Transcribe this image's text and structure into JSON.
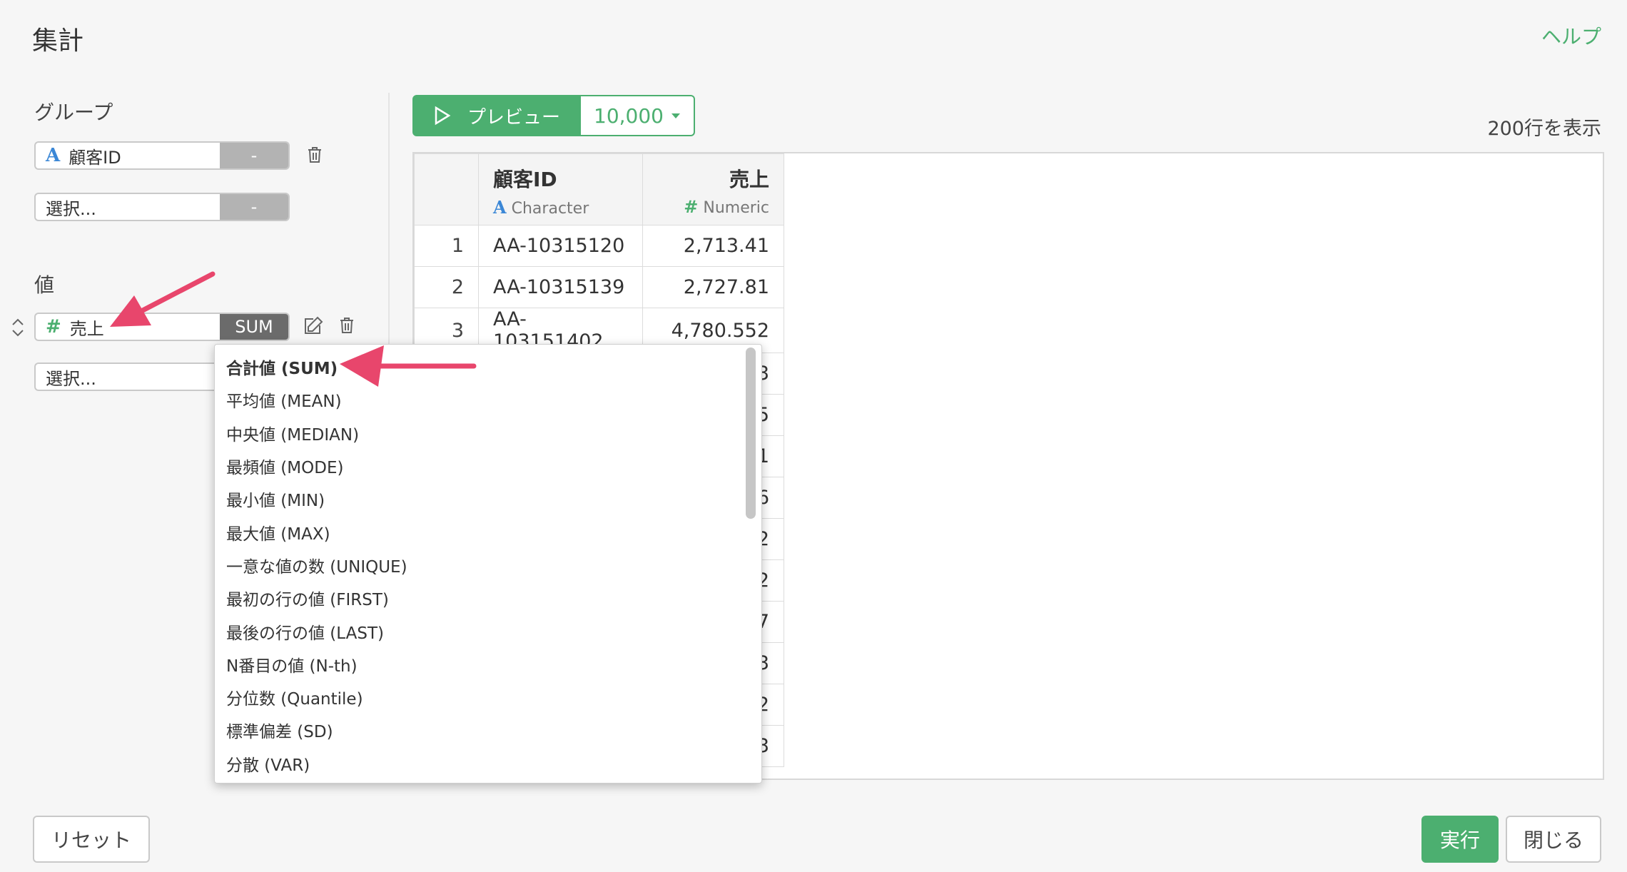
{
  "header": {
    "title": "集計",
    "help_label": "ヘルプ"
  },
  "left_panel": {
    "group_label": "グループ",
    "group_fields": [
      {
        "value": "顧客ID",
        "type_icon": "A",
        "button": "-"
      },
      {
        "placeholder": "選択...",
        "button": "-"
      }
    ],
    "value_label": "値",
    "value_fields": [
      {
        "value": "売上",
        "type_icon": "#",
        "button": "SUM"
      },
      {
        "placeholder": "選択..."
      }
    ]
  },
  "preview": {
    "button_label": "プレビュー",
    "count": "10,000",
    "rows_info": "200行を表示"
  },
  "table": {
    "columns": [
      {
        "name": "顧客ID",
        "type_icon": "A",
        "type": "Character"
      },
      {
        "name": "売上",
        "type_icon": "#",
        "type": "Numeric"
      }
    ],
    "rows": [
      {
        "index": "1",
        "id": "AA-10315120",
        "value": "2,713.41"
      },
      {
        "index": "2",
        "id": "AA-10315139",
        "value": "2,727.81"
      },
      {
        "index": "3",
        "id": "AA-103151402",
        "value": "4,780.552"
      }
    ],
    "partial_values": [
      "3",
      "5",
      "1",
      "6",
      "2",
      "2",
      "7",
      "3",
      "2",
      "3"
    ]
  },
  "aggregate_menu": {
    "selected": "合計値 (SUM)",
    "options": [
      "合計値 (SUM)",
      "平均値 (MEAN)",
      "中央値 (MEDIAN)",
      "最頻値 (MODE)",
      "最小値 (MIN)",
      "最大値 (MAX)",
      "一意な値の数 (UNIQUE)",
      "最初の行の値 (FIRST)",
      "最後の行の値 (LAST)",
      "N番目の値 (N-th)",
      "分位数 (Quantile)",
      "標準偏差 (SD)",
      "分散 (VAR)"
    ]
  },
  "footer": {
    "reset_label": "リセット",
    "run_label": "実行",
    "close_label": "閉じる"
  },
  "colors": {
    "accent": "#4caf70",
    "annotation_arrow": "#e8466c",
    "character_type": "#3b87d6"
  }
}
